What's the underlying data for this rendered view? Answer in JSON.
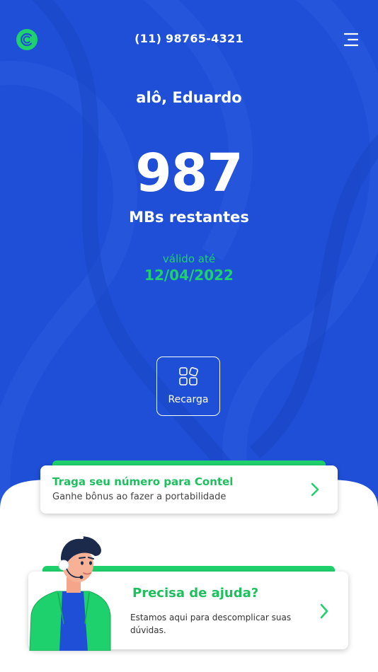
{
  "colors": {
    "background": "#1f4fd6",
    "accent_green": "#1fd16d",
    "text_white": "#ffffff",
    "card_bg": "#ffffff"
  },
  "header": {
    "logo_icon": "contel-logo-icon",
    "phone_number": "(11) 98765-4321",
    "menu_icon": "menu-icon"
  },
  "balance": {
    "greeting": "alô, Eduardo",
    "amount": "987",
    "unit_label": "MBs restantes",
    "valid_label": "válido até",
    "valid_date": "12/04/2022"
  },
  "actions": {
    "recarga_label": "Recarga",
    "recarga_icon": "apps-grid-icon"
  },
  "cards": {
    "portability": {
      "title": "Traga seu número para Contel",
      "subtitle": "Ganhe bônus ao fazer a portabilidade",
      "icon": "chevron-right-icon"
    },
    "help": {
      "title": "Precisa de ajuda?",
      "subtitle": "Estamos aqui para descomplicar suas dúvidas.",
      "icon": "chevron-right-icon",
      "illustration": "support-agent-illustration"
    }
  }
}
